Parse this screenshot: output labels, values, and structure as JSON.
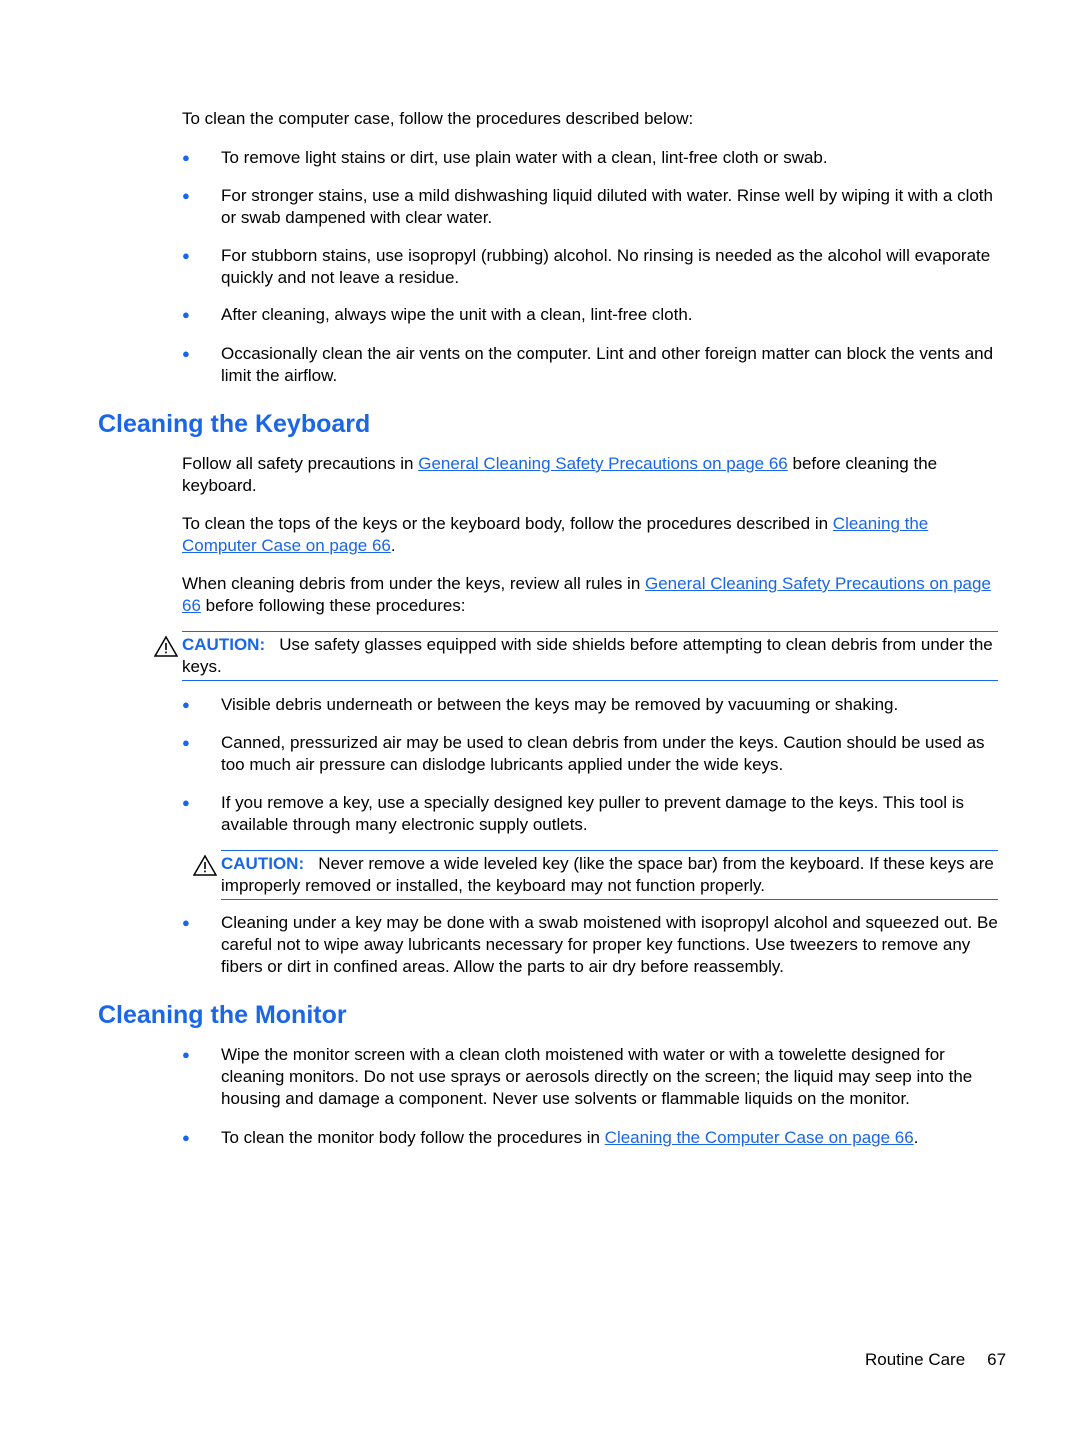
{
  "intro": "To clean the computer case, follow the procedures described below:",
  "case_bullets": [
    "To remove light stains or dirt, use plain water with a clean, lint-free cloth or swab.",
    "For stronger stains, use a mild dishwashing liquid diluted with water. Rinse well by wiping it with a cloth or swab dampened with clear water.",
    "For stubborn stains, use isopropyl (rubbing) alcohol. No rinsing is needed as the alcohol will evaporate quickly and not leave a residue.",
    "After cleaning, always wipe the unit with a clean, lint-free cloth.",
    "Occasionally clean the air vents on the computer. Lint and other foreign matter can block the vents and limit the airflow."
  ],
  "keyboard": {
    "heading": "Cleaning the Keyboard",
    "p1": {
      "before": "Follow all safety precautions in ",
      "link": "General Cleaning Safety Precautions on page 66",
      "after": " before cleaning the keyboard."
    },
    "p2": {
      "before": "To clean the tops of the keys or the keyboard body, follow the procedures described in ",
      "link": "Cleaning the Computer Case on page 66",
      "after": "."
    },
    "p3": {
      "before": "When cleaning debris from under the keys, review all rules in ",
      "link": "General Cleaning Safety Precautions on page 66",
      "after": " before following these procedures:"
    },
    "caution1": {
      "label": "CAUTION:",
      "text": "Use safety glasses equipped with side shields before attempting to clean debris from under the keys."
    },
    "bullets": [
      "Visible debris underneath or between the keys may be removed by vacuuming or shaking.",
      "Canned, pressurized air may be used to clean debris from under the keys. Caution should be used as too much air pressure can dislodge lubricants applied under the wide keys.",
      "If you remove a key, use a specially designed key puller to prevent damage to the keys. This tool is available through many electronic supply outlets."
    ],
    "caution2": {
      "label": "CAUTION:",
      "text": "Never remove a wide leveled key (like the space bar) from the keyboard. If these keys are improperly removed or installed, the keyboard may not function properly."
    },
    "last_bullet": "Cleaning under a key may be done with a swab moistened with isopropyl alcohol and squeezed out. Be careful not to wipe away lubricants necessary for proper key functions. Use tweezers to remove any fibers or dirt in confined areas. Allow the parts to air dry before reassembly."
  },
  "monitor": {
    "heading": "Cleaning the Monitor",
    "bullet1": "Wipe the monitor screen with a clean cloth moistened with water or with a towelette designed for cleaning monitors. Do not use sprays or aerosols directly on the screen; the liquid may seep into the housing and damage a component. Never use solvents or flammable liquids on the monitor.",
    "bullet2": {
      "before": "To clean the monitor body follow the procedures in ",
      "link": "Cleaning the Computer Case on page 66",
      "after": "."
    }
  },
  "footer": {
    "section": "Routine Care",
    "page": "67"
  },
  "bullet_glyph": "●",
  "accent_color": "#1a66e8"
}
